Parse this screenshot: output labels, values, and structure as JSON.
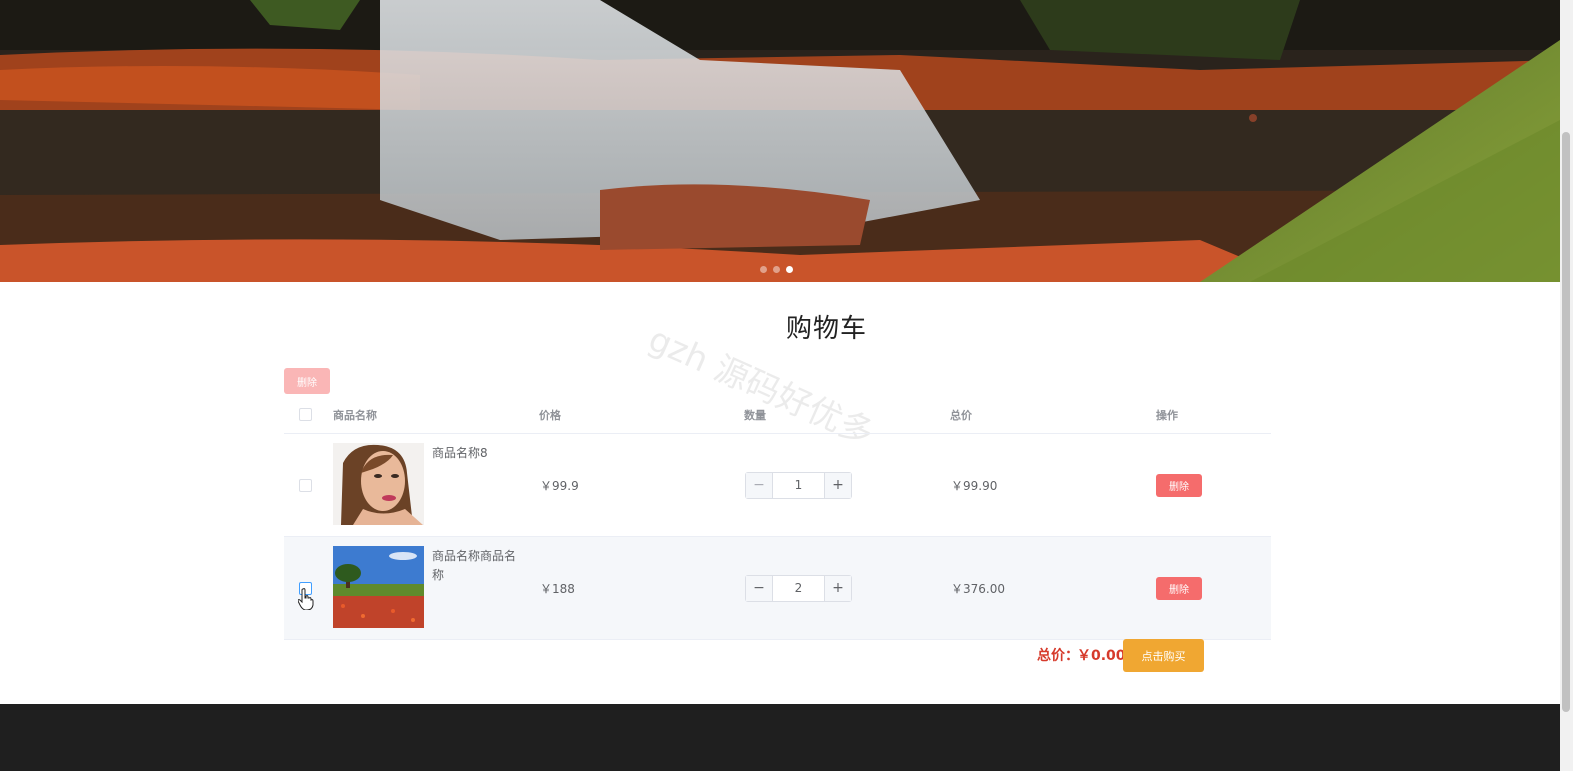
{
  "banner": {
    "slides_total": 3,
    "active_slide": 3
  },
  "cart": {
    "title": "购物车",
    "watermark": "gzh 源码好优多",
    "batch_delete_label": "删除",
    "columns": [
      "商品名称",
      "价格",
      "数量",
      "总价",
      "操作"
    ],
    "rows": [
      {
        "name": "商品名称8",
        "price": "￥99.9",
        "quantity": "1",
        "total": "￥99.90",
        "action": "删除",
        "image": "woman-portrait"
      },
      {
        "name": "商品名称商品名称",
        "price": "￥188",
        "quantity": "2",
        "total": "￥376.00",
        "action": "删除",
        "image": "tree-flower-field"
      }
    ],
    "summary_label": "总价：",
    "summary_value": "￥0.00",
    "buy_label": "点击购买"
  },
  "colors": {
    "danger": "#f56c6c",
    "danger_light": "#fab6b6",
    "warning": "#f0a732",
    "total_red": "#d63a2b",
    "footer": "#1f1f1f"
  }
}
